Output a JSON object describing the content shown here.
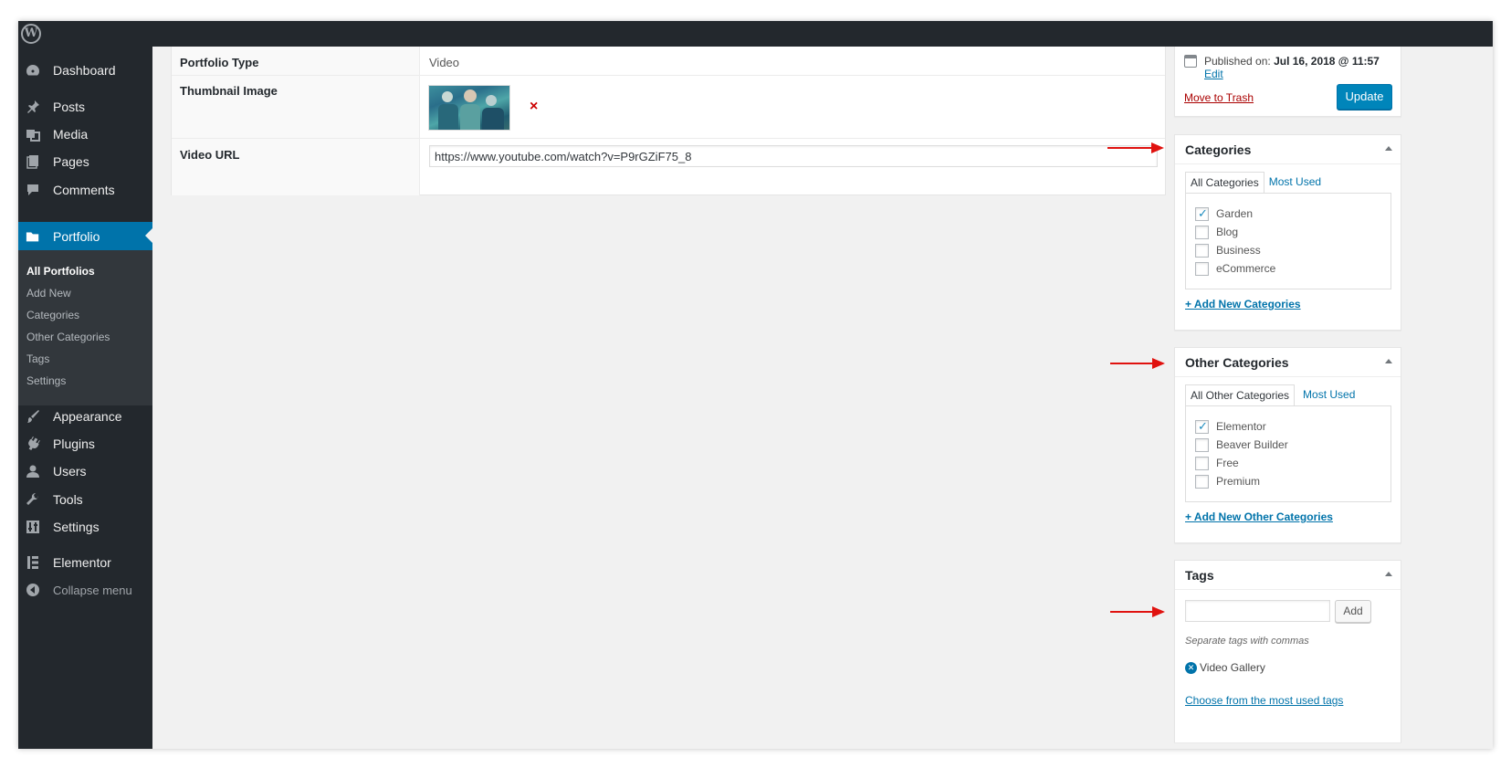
{
  "adminbar": {
    "logo": "W"
  },
  "sidebar": {
    "items": [
      {
        "label": "Dashboard",
        "icon": "dashboard-icon"
      },
      {
        "label": "Posts",
        "icon": "pin-icon"
      },
      {
        "label": "Media",
        "icon": "media-icon"
      },
      {
        "label": "Pages",
        "icon": "pages-icon"
      },
      {
        "label": "Comments",
        "icon": "comment-icon"
      },
      {
        "label": "Portfolio",
        "icon": "folder-icon",
        "active": true
      },
      {
        "label": "Appearance",
        "icon": "brush-icon"
      },
      {
        "label": "Plugins",
        "icon": "plug-icon"
      },
      {
        "label": "Users",
        "icon": "user-icon"
      },
      {
        "label": "Tools",
        "icon": "wrench-icon"
      },
      {
        "label": "Settings",
        "icon": "settings-icon"
      },
      {
        "label": "Elementor",
        "icon": "elementor-icon"
      }
    ],
    "submenu": [
      "All Portfolios",
      "Add New",
      "Categories",
      "Other Categories",
      "Tags",
      "Settings"
    ],
    "collapse_label": "Collapse menu"
  },
  "main": {
    "fields": [
      {
        "label": "Portfolio Type",
        "value": "Video"
      },
      {
        "label": "Thumbnail Image",
        "remove": "×"
      },
      {
        "label": "Video URL",
        "value": "https://www.youtube.com/watch?v=P9rGZiF75_8"
      }
    ]
  },
  "publish": {
    "published_label": "Published on:",
    "published_date": "Jul 16, 2018 @ 11:57",
    "edit_link": "Edit",
    "trash_link": "Move to Trash",
    "update_button": "Update"
  },
  "categories": {
    "title": "Categories",
    "tabs": [
      "All Categories",
      "Most Used"
    ],
    "items": [
      {
        "label": "Garden",
        "checked": true
      },
      {
        "label": "Blog",
        "checked": false
      },
      {
        "label": "Business",
        "checked": false
      },
      {
        "label": "eCommerce",
        "checked": false
      }
    ],
    "add_link": "+ Add New Categories"
  },
  "other_categories": {
    "title": "Other Categories",
    "tabs": [
      "All Other Categories",
      "Most Used"
    ],
    "items": [
      {
        "label": "Elementor",
        "checked": true
      },
      {
        "label": "Beaver Builder",
        "checked": false
      },
      {
        "label": "Free",
        "checked": false
      },
      {
        "label": "Premium",
        "checked": false
      }
    ],
    "add_link": "+ Add New Other Categories"
  },
  "tags": {
    "title": "Tags",
    "input_value": "",
    "add_button": "Add",
    "hint": "Separate tags with commas",
    "chips": [
      "Video Gallery"
    ],
    "cloud_link": "Choose from the most used tags"
  },
  "colors": {
    "sidebar_bg": "#23282d",
    "accent": "#0073aa",
    "button_primary": "#0085ba",
    "annotation_arrow": "#e0120f",
    "trash": "#aa0000"
  }
}
